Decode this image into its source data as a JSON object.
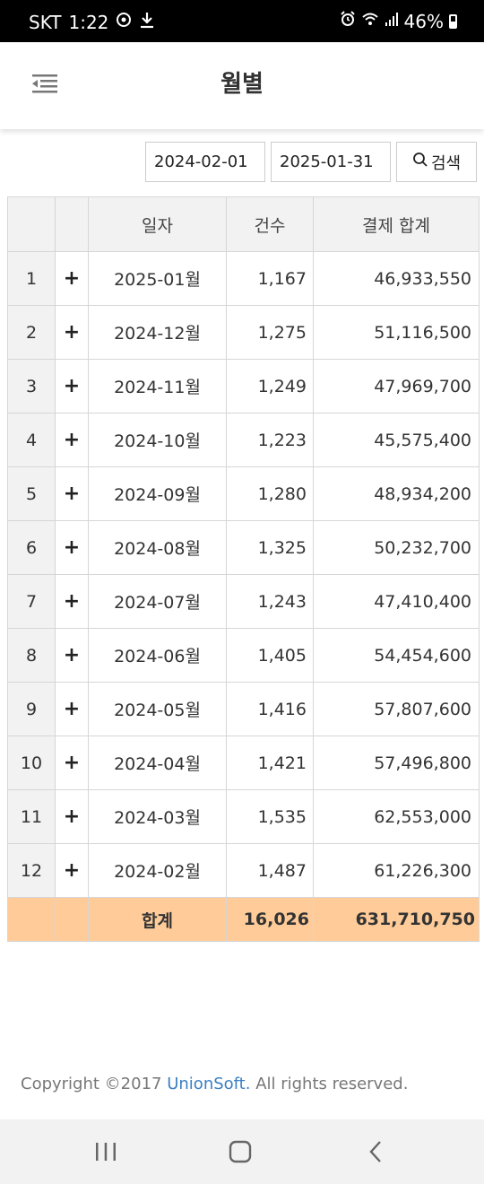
{
  "status": {
    "carrier": "SKT",
    "time": "1:22",
    "battery": "46%"
  },
  "header": {
    "title": "월별"
  },
  "search": {
    "start_date": "2024-02-01",
    "end_date": "2025-01-31",
    "button_label": "검색"
  },
  "table": {
    "columns": [
      "",
      "",
      "일자",
      "건수",
      "결제 합계"
    ],
    "rows": [
      {
        "no": "1",
        "expand": "+",
        "month": "2025-01월",
        "count": "1,167",
        "amount": "46,933,550"
      },
      {
        "no": "2",
        "expand": "+",
        "month": "2024-12월",
        "count": "1,275",
        "amount": "51,116,500"
      },
      {
        "no": "3",
        "expand": "+",
        "month": "2024-11월",
        "count": "1,249",
        "amount": "47,969,700"
      },
      {
        "no": "4",
        "expand": "+",
        "month": "2024-10월",
        "count": "1,223",
        "amount": "45,575,400"
      },
      {
        "no": "5",
        "expand": "+",
        "month": "2024-09월",
        "count": "1,280",
        "amount": "48,934,200"
      },
      {
        "no": "6",
        "expand": "+",
        "month": "2024-08월",
        "count": "1,325",
        "amount": "50,232,700"
      },
      {
        "no": "7",
        "expand": "+",
        "month": "2024-07월",
        "count": "1,243",
        "amount": "47,410,400"
      },
      {
        "no": "8",
        "expand": "+",
        "month": "2024-06월",
        "count": "1,405",
        "amount": "54,454,600"
      },
      {
        "no": "9",
        "expand": "+",
        "month": "2024-05월",
        "count": "1,416",
        "amount": "57,807,600"
      },
      {
        "no": "10",
        "expand": "+",
        "month": "2024-04월",
        "count": "1,421",
        "amount": "57,496,800"
      },
      {
        "no": "11",
        "expand": "+",
        "month": "2024-03월",
        "count": "1,535",
        "amount": "62,553,000"
      },
      {
        "no": "12",
        "expand": "+",
        "month": "2024-02월",
        "count": "1,487",
        "amount": "61,226,300"
      }
    ],
    "total": {
      "label": "합계",
      "count": "16,026",
      "amount": "631,710,750"
    }
  },
  "footer": {
    "prefix": "Copyright ©2017 ",
    "brand": "UnionSoft.",
    "suffix": " All rights reserved."
  },
  "colors": {
    "total_row": "#ffcc99",
    "header_bg": "#f2f2f2",
    "brand_link": "#3a7fc4"
  },
  "icons": {
    "menu": "menu-collapse-icon",
    "search": "search-icon",
    "recents": "recent-apps-icon",
    "home": "home-icon",
    "back": "back-icon"
  }
}
